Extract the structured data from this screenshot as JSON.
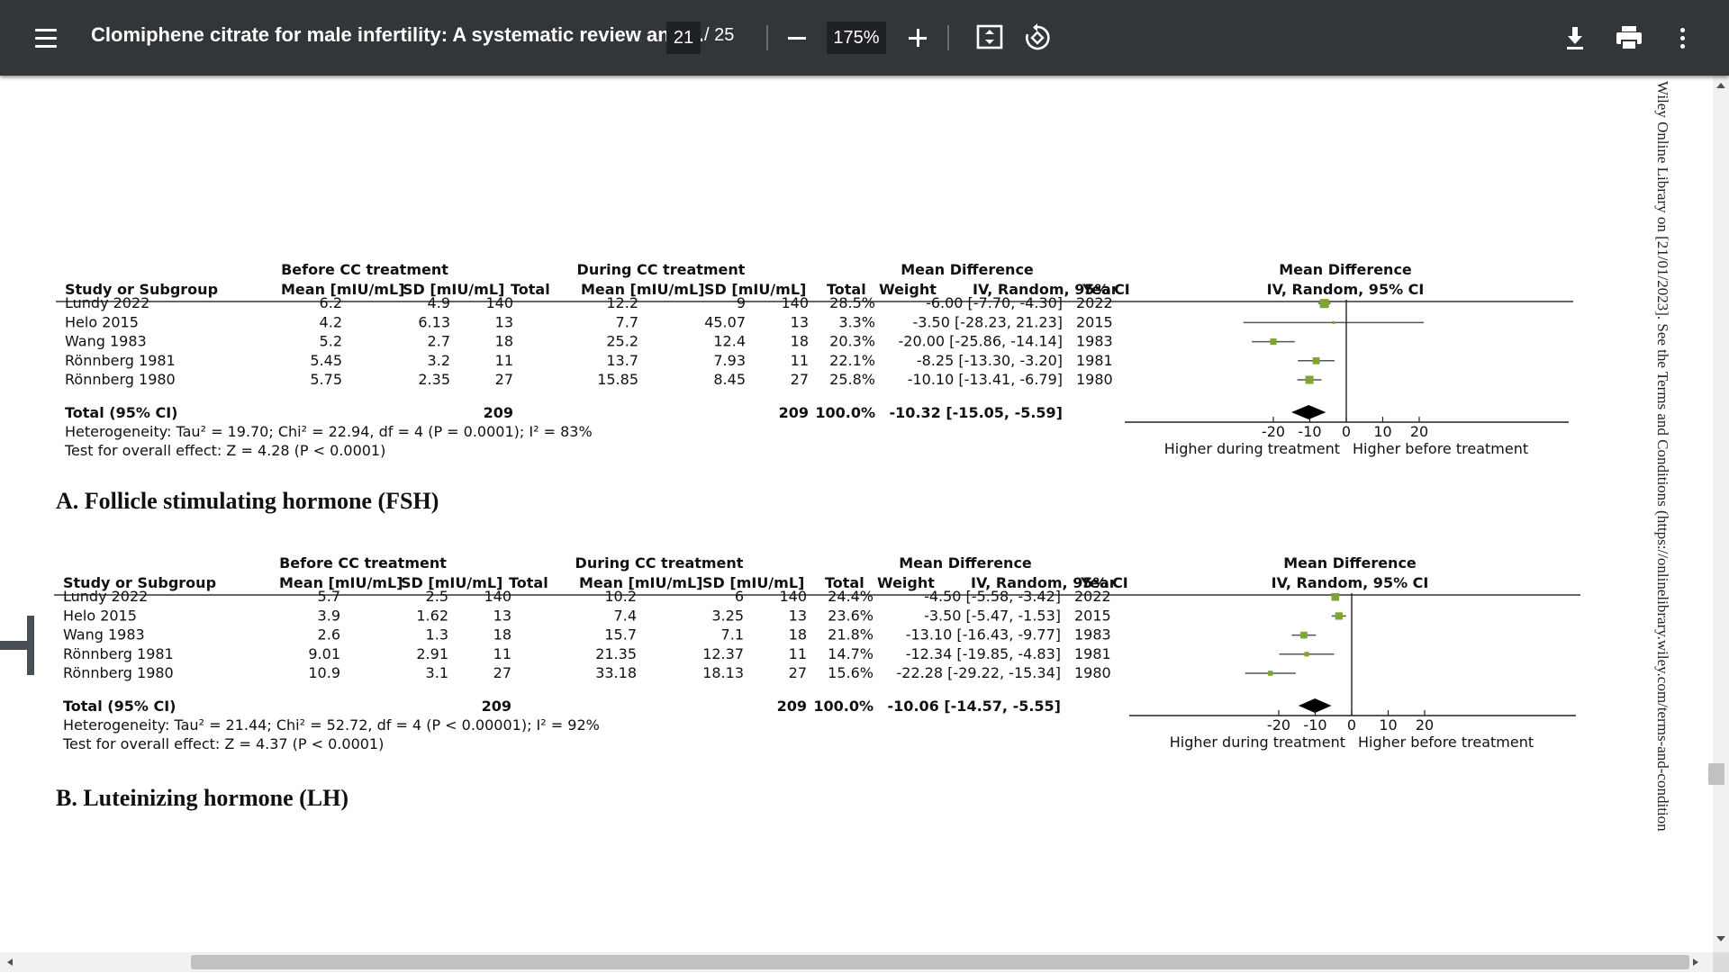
{
  "toolbar": {
    "title": "Clomiphene citrate for male infertility: A systematic review and ...",
    "page_current": "21",
    "page_total": "/ 25",
    "zoom": "175%",
    "icons": [
      "menu-icon",
      "minus-icon",
      "plus-icon",
      "fit-page-icon",
      "rotate-icon",
      "download-icon",
      "print-icon",
      "more-vert-icon"
    ]
  },
  "side_text": "Wiley Online Library on [21/01/2023]. See the Terms and Conditions (https://onlinelibrary.wiley.com/terms-and-condition",
  "header_labels": {
    "before": "Before CC treatment",
    "during": "During CC treatment",
    "md": "Mean Difference",
    "md_plot": "Mean Difference",
    "study": "Study or Subgroup",
    "mean_b": "Mean [mIU/mL]",
    "sd_b": "SD [mIU/mL]",
    "total_b": "Total",
    "mean_d": "Mean [mIU/mL]",
    "sd_d": "SD [mIU/mL]",
    "total_d": "Total",
    "weight": "Weight",
    "ci": "IV, Random, 95% CI",
    "year": "Year",
    "ci_plot": "IV, Random, 95% CI",
    "total_row": "Total (95% CI)",
    "axis_left": "Higher during treatment",
    "axis_right": "Higher before treatment",
    "ticks": [
      "-20",
      "-10",
      "0",
      "10",
      "20"
    ]
  },
  "chart_data": [
    {
      "type": "table",
      "caption": "A. Follicle stimulating hormone (FSH)",
      "rows": [
        {
          "study": "Lundy 2022",
          "mean_b": "6.2",
          "sd_b": "4.9",
          "n_b": "140",
          "mean_d": "12.2",
          "sd_d": "9",
          "n_d": "140",
          "weight": "28.5%",
          "ci": "-6.00 [-7.70, -4.30]",
          "year": "2022",
          "md": -6.0,
          "lo": -7.7,
          "hi": -4.3
        },
        {
          "study": "Helo 2015",
          "mean_b": "4.2",
          "sd_b": "6.13",
          "n_b": "13",
          "mean_d": "7.7",
          "sd_d": "45.07",
          "n_d": "13",
          "weight": "3.3%",
          "ci": "-3.50 [-28.23, 21.23]",
          "year": "2015",
          "md": -3.5,
          "lo": -28.23,
          "hi": 21.23
        },
        {
          "study": "Wang 1983",
          "mean_b": "5.2",
          "sd_b": "2.7",
          "n_b": "18",
          "mean_d": "25.2",
          "sd_d": "12.4",
          "n_d": "18",
          "weight": "20.3%",
          "ci": "-20.00 [-25.86, -14.14]",
          "year": "1983",
          "md": -20.0,
          "lo": -25.86,
          "hi": -14.14
        },
        {
          "study": "Rönnberg 1981",
          "mean_b": "5.45",
          "sd_b": "3.2",
          "n_b": "11",
          "mean_d": "13.7",
          "sd_d": "7.93",
          "n_d": "11",
          "weight": "22.1%",
          "ci": "-8.25 [-13.30, -3.20]",
          "year": "1981",
          "md": -8.25,
          "lo": -13.3,
          "hi": -3.2
        },
        {
          "study": "Rönnberg 1980",
          "mean_b": "5.75",
          "sd_b": "2.35",
          "n_b": "27",
          "mean_d": "15.85",
          "sd_d": "8.45",
          "n_d": "27",
          "weight": "25.8%",
          "ci": "-10.10 [-13.41, -6.79]",
          "year": "1980",
          "md": -10.1,
          "lo": -13.41,
          "hi": -6.79
        }
      ],
      "total": {
        "n_b": "209",
        "n_d": "209",
        "weight": "100.0%",
        "ci": "-10.32 [-15.05, -5.59]",
        "md": -10.32,
        "lo": -15.05,
        "hi": -5.59
      },
      "heterogeneity": "Heterogeneity: Tau² = 19.70; Chi² = 22.94, df = 4 (P = 0.0001); I² = 83%",
      "overall": "Test for overall effect: Z = 4.28 (P < 0.0001)",
      "xlim": [
        -30,
        30
      ]
    },
    {
      "type": "table",
      "caption": "B. Luteinizing hormone (LH)",
      "rows": [
        {
          "study": "Lundy 2022",
          "mean_b": "5.7",
          "sd_b": "2.5",
          "n_b": "140",
          "mean_d": "10.2",
          "sd_d": "6",
          "n_d": "140",
          "weight": "24.4%",
          "ci": "-4.50 [-5.58, -3.42]",
          "year": "2022",
          "md": -4.5,
          "lo": -5.58,
          "hi": -3.42
        },
        {
          "study": "Helo 2015",
          "mean_b": "3.9",
          "sd_b": "1.62",
          "n_b": "13",
          "mean_d": "7.4",
          "sd_d": "3.25",
          "n_d": "13",
          "weight": "23.6%",
          "ci": "-3.50 [-5.47, -1.53]",
          "year": "2015",
          "md": -3.5,
          "lo": -5.47,
          "hi": -1.53
        },
        {
          "study": "Wang 1983",
          "mean_b": "2.6",
          "sd_b": "1.3",
          "n_b": "18",
          "mean_d": "15.7",
          "sd_d": "7.1",
          "n_d": "18",
          "weight": "21.8%",
          "ci": "-13.10 [-16.43, -9.77]",
          "year": "1983",
          "md": -13.1,
          "lo": -16.43,
          "hi": -9.77
        },
        {
          "study": "Rönnberg 1981",
          "mean_b": "9.01",
          "sd_b": "2.91",
          "n_b": "11",
          "mean_d": "21.35",
          "sd_d": "12.37",
          "n_d": "11",
          "weight": "14.7%",
          "ci": "-12.34 [-19.85, -4.83]",
          "year": "1981",
          "md": -12.34,
          "lo": -19.85,
          "hi": -4.83
        },
        {
          "study": "Rönnberg 1980",
          "mean_b": "10.9",
          "sd_b": "3.1",
          "n_b": "27",
          "mean_d": "33.18",
          "sd_d": "18.13",
          "n_d": "27",
          "weight": "15.6%",
          "ci": "-22.28 [-29.22, -15.34]",
          "year": "1980",
          "md": -22.28,
          "lo": -29.22,
          "hi": -15.34
        }
      ],
      "total": {
        "n_b": "209",
        "n_d": "209",
        "weight": "100.0%",
        "ci": "-10.06 [-14.57, -5.55]",
        "md": -10.06,
        "lo": -14.57,
        "hi": -5.55
      },
      "heterogeneity": "Heterogeneity: Tau² = 21.44; Chi² = 52.72, df = 4 (P < 0.00001); I² = 92%",
      "overall": "Test for overall effect: Z = 4.37 (P < 0.0001)",
      "xlim": [
        -30,
        30
      ]
    }
  ]
}
